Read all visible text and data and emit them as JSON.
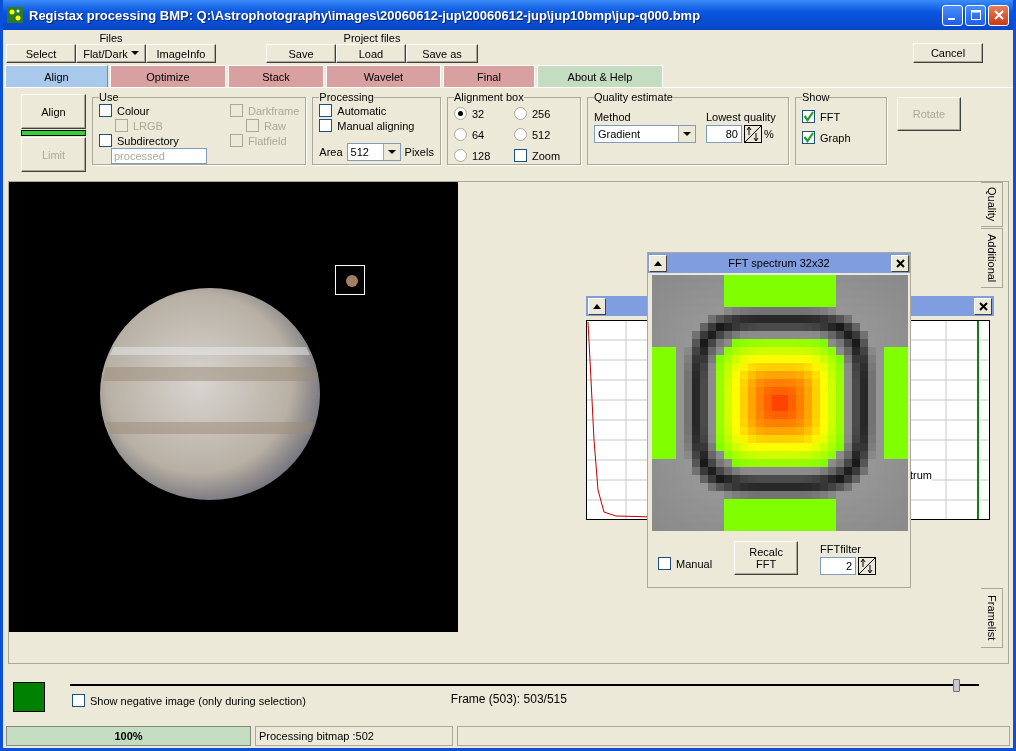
{
  "window": {
    "title": "Registax processing BMP: Q:\\Astrophotography\\images\\20060612-jup\\20060612-jup\\jup10bmp\\jup-q000.bmp"
  },
  "files": {
    "label": "Files",
    "buttons": [
      {
        "label": "Select",
        "kind": "button"
      },
      {
        "label": "Flat/Dark",
        "kind": "dropdown"
      },
      {
        "label": "ImageInfo",
        "kind": "button"
      }
    ]
  },
  "project_files": {
    "label": "Project files",
    "buttons": [
      "Save",
      "Load",
      "Save as"
    ]
  },
  "cancel_button": "Cancel",
  "tabs": [
    {
      "label": "Align",
      "selected": true,
      "color": "#a8c8ec"
    },
    {
      "label": "Optimize",
      "selected": false,
      "color": "#d8a0a0"
    },
    {
      "label": "Stack",
      "selected": false,
      "color": "#d8a0a0"
    },
    {
      "label": "Wavelet",
      "selected": false,
      "color": "#d8a0a0"
    },
    {
      "label": "Final",
      "selected": false,
      "color": "#d8a0a0"
    },
    {
      "label": "About & Help",
      "selected": false,
      "color": "#c4dcc0"
    }
  ],
  "align_button": "Align",
  "limit_button": {
    "label": "Limit",
    "disabled": true
  },
  "use": {
    "title": "Use",
    "columns": [
      [
        {
          "label": "Colour",
          "checked": false,
          "disabled": false,
          "children": [
            {
              "label": "LRGB",
              "checked": false,
              "disabled": true
            }
          ]
        },
        {
          "label": "Subdirectory",
          "checked": false,
          "disabled": false
        }
      ],
      [
        {
          "label": "Darkframe",
          "checked": false,
          "disabled": true,
          "children": [
            {
              "label": "Raw",
              "checked": false,
              "disabled": true
            }
          ]
        },
        {
          "label": "Flatfield",
          "checked": false,
          "disabled": true
        }
      ]
    ],
    "subdirectory": {
      "value": "processed",
      "disabled": true
    }
  },
  "processing": {
    "title": "Processing",
    "options": [
      {
        "label": "Automatic",
        "checked": false
      },
      {
        "label": "Manual aligning",
        "checked": false
      }
    ],
    "area_label": "Area",
    "area_value": "512",
    "unit": "Pixels"
  },
  "alignment_box": {
    "title": "Alignment box",
    "options": [
      {
        "label": "32",
        "selected": true
      },
      {
        "label": "256",
        "selected": false
      },
      {
        "label": "64",
        "selected": false
      },
      {
        "label": "512",
        "selected": false
      },
      {
        "label": "128",
        "selected": false
      }
    ],
    "zoom": {
      "label": "Zoom",
      "checked": false
    }
  },
  "quality_estimate": {
    "title": "Quality estimate",
    "method_label": "Method",
    "method_value": "Gradient",
    "lowest_label": "Lowest quality",
    "lowest_value": "80",
    "unit": "%"
  },
  "show": {
    "title": "Show",
    "options": [
      {
        "label": "FFT",
        "checked": true
      },
      {
        "label": "Graph",
        "checked": true
      }
    ]
  },
  "rotate_button": {
    "label": "Rotate",
    "disabled": true
  },
  "side_tabs": [
    "Quality",
    "Additional",
    "Framelist"
  ],
  "graph_window": {
    "visible_text": "trum"
  },
  "fft_window": {
    "title": "FFT spectrum 32x32",
    "manual": {
      "label": "Manual",
      "checked": false
    },
    "recalc_button": "Recalc\nFFT",
    "filter_label": "FFTfilter",
    "filter_value": "2"
  },
  "negative": {
    "label": "Show negative image (only during selection)",
    "checked": false
  },
  "frame_label": "Frame (503): 503/515",
  "frame_slider": {
    "level": 0.976
  },
  "status_bar": {
    "progress": {
      "label": "100%",
      "level": 1
    },
    "message": "Processing bitmap :502"
  }
}
